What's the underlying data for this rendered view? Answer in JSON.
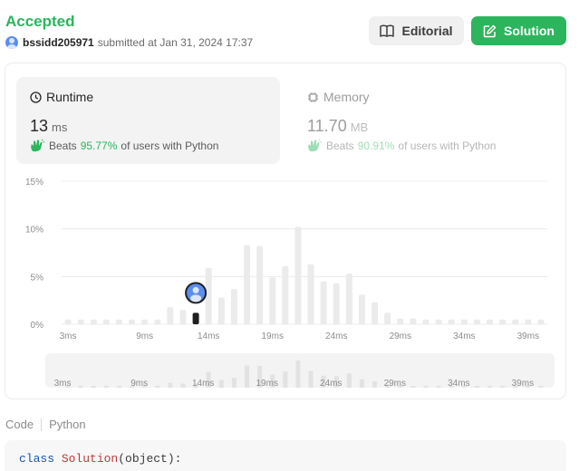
{
  "header": {
    "status": "Accepted",
    "username": "bssidd205971",
    "submitted_text": "submitted at Jan 31, 2024 17:37",
    "editorial_label": "Editorial",
    "solution_label": "Solution",
    "accent_color": "#2db55d"
  },
  "runtime": {
    "title": "Runtime",
    "value": "13",
    "unit": "ms",
    "beats_label": "Beats",
    "beats_pct": "95.77%",
    "beats_suffix": "of users with Python"
  },
  "memory": {
    "title": "Memory",
    "value": "11.70",
    "unit": "MB",
    "beats_label": "Beats",
    "beats_pct": "90.91%",
    "beats_suffix": "of users with Python"
  },
  "chart_data": {
    "type": "bar",
    "title": "",
    "xlabel": "",
    "ylabel": "",
    "ylim": [
      0,
      15
    ],
    "y_ticks": [
      "15%",
      "10%",
      "5%",
      "0%"
    ],
    "x_ticks": [
      "3ms",
      "9ms",
      "14ms",
      "19ms",
      "24ms",
      "29ms",
      "34ms",
      "39ms"
    ],
    "categories": [
      "3ms",
      "4ms",
      "5ms",
      "6ms",
      "7ms",
      "8ms",
      "9ms",
      "10ms",
      "11ms",
      "12ms",
      "13ms",
      "14ms",
      "15ms",
      "16ms",
      "17ms",
      "18ms",
      "19ms",
      "20ms",
      "21ms",
      "22ms",
      "23ms",
      "24ms",
      "25ms",
      "26ms",
      "27ms",
      "28ms",
      "29ms",
      "30ms",
      "31ms",
      "32ms",
      "33ms",
      "34ms",
      "35ms",
      "36ms",
      "37ms",
      "38ms",
      "39ms",
      "40ms"
    ],
    "values": [
      0.5,
      0.5,
      0.5,
      0.5,
      0.5,
      0.5,
      0.5,
      0.5,
      1.8,
      1.5,
      1.2,
      5.9,
      2.8,
      3.7,
      8.3,
      8.2,
      4.9,
      6.1,
      10.2,
      6.3,
      4.5,
      4.3,
      5.3,
      3.1,
      2.3,
      1.2,
      0.6,
      0.6,
      0.5,
      0.5,
      0.5,
      0.5,
      0.5,
      0.5,
      0.5,
      0.5,
      0.5,
      0.5
    ],
    "highlight_category": "13ms",
    "grid": true,
    "bar_color": "#ebebeb",
    "highlight_color": "#1f1f1f"
  },
  "code": {
    "tab_code": "Code",
    "tab_lang": "Python",
    "line1_kw": "class",
    "line1_name": "Solution",
    "line1_rest": "(object):"
  }
}
